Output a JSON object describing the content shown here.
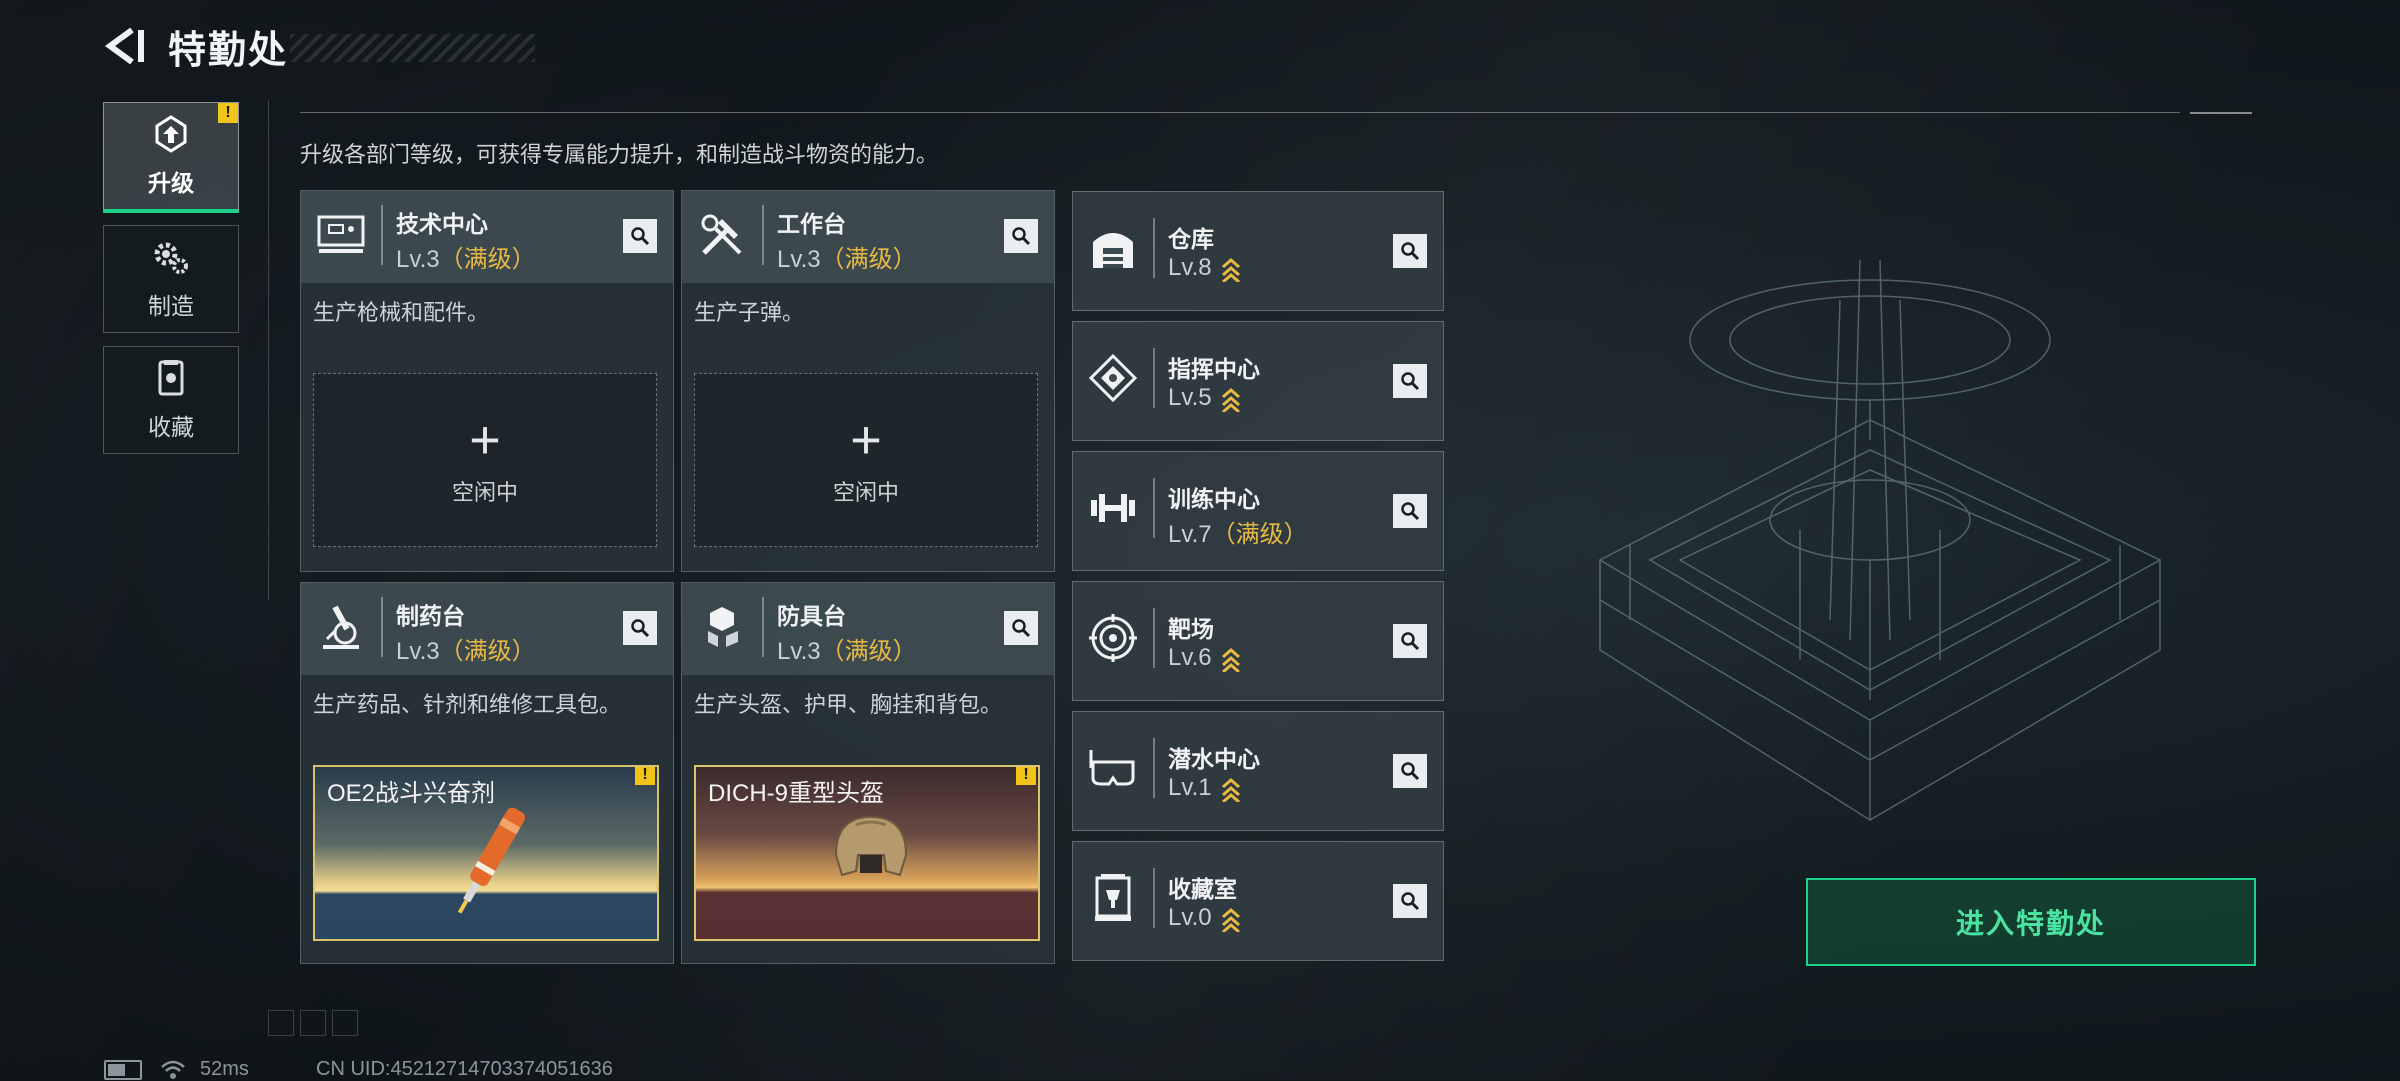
{
  "header": {
    "title": "特勤处",
    "back_icon": "back-arrow-icon"
  },
  "side_nav": [
    {
      "label": "升级",
      "icon": "upgrade-icon",
      "active": true,
      "badge": "!"
    },
    {
      "label": "制造",
      "icon": "gears-icon",
      "active": false
    },
    {
      "label": "收藏",
      "icon": "collection-icon",
      "active": false
    }
  ],
  "description": "升级各部门等级，可获得专属能力提升，和制造战斗物资的能力。",
  "large_cards": [
    {
      "name": "技术中心",
      "level": "Lv.3",
      "max_tag": "（满级）",
      "desc": "生产枪械和配件。",
      "slot_status": "空闲中",
      "icon": "monitor-icon"
    },
    {
      "name": "工作台",
      "level": "Lv.3",
      "max_tag": "（满级）",
      "desc": "生产子弹。",
      "slot_status": "空闲中",
      "icon": "tools-icon"
    },
    {
      "name": "制药台",
      "level": "Lv.3",
      "max_tag": "（满级）",
      "desc": "生产药品、针剂和维修工具包。",
      "item": "OE2战斗兴奋剂",
      "badge": "!",
      "icon": "microscope-icon"
    },
    {
      "name": "防具台",
      "level": "Lv.3",
      "max_tag": "（满级）",
      "desc": "生产头盔、护甲、胸挂和背包。",
      "item": "DICH-9重型头盔",
      "badge": "!",
      "icon": "armor-blocks-icon"
    }
  ],
  "small_cards": [
    {
      "name": "仓库",
      "level": "Lv.8",
      "max_tag": "",
      "upgradable": true,
      "icon": "warehouse-icon"
    },
    {
      "name": "指挥中心",
      "level": "Lv.5",
      "max_tag": "",
      "upgradable": true,
      "icon": "command-chip-icon"
    },
    {
      "name": "训练中心",
      "level": "Lv.7",
      "max_tag": "（满级）",
      "upgradable": false,
      "icon": "dumbbell-icon"
    },
    {
      "name": "靶场",
      "level": "Lv.6",
      "max_tag": "",
      "upgradable": true,
      "icon": "target-icon"
    },
    {
      "name": "潜水中心",
      "level": "Lv.1",
      "max_tag": "",
      "upgradable": true,
      "icon": "diving-mask-icon"
    },
    {
      "name": "收藏室",
      "level": "Lv.0",
      "max_tag": "",
      "upgradable": true,
      "icon": "trophy-case-icon"
    }
  ],
  "enter_button": "进入特勤处",
  "status_bar": {
    "ping": "52ms",
    "uid": "CN UID:45212714703374051636",
    "battery_level": 0.6
  },
  "colors": {
    "accent": "#1ed28a",
    "max_level": "#e9b944",
    "warning": "#f0c419"
  }
}
